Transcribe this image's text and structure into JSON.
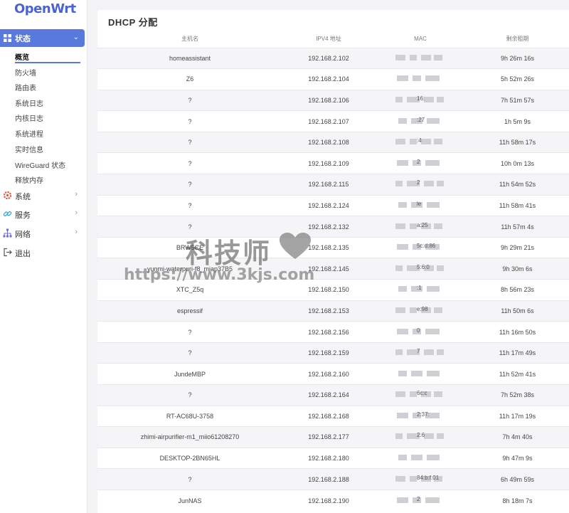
{
  "brand": {
    "logo_text": "OpenWrt",
    "accent": "#5a79dc"
  },
  "sidebar": {
    "active_section": {
      "label": "状态",
      "icon": "grid-icon"
    },
    "status_items": [
      "概览",
      "防火墙",
      "路由表",
      "系统日志",
      "内核日志",
      "系统进程",
      "实时信息",
      "WireGuard 状态",
      "释放内存"
    ],
    "active_sub_index": 0,
    "sections": [
      {
        "label": "系统",
        "icon": "gear-icon",
        "icon_color": "#e0553a"
      },
      {
        "label": "服务",
        "icon": "link-icon",
        "icon_color": "#3aa6d8"
      },
      {
        "label": "网络",
        "icon": "network-icon",
        "icon_color": "#6a6fd0"
      },
      {
        "label": "退出",
        "icon": "logout-icon",
        "icon_color": "#555555"
      }
    ]
  },
  "main": {
    "title": "DHCP 分配",
    "columns": [
      "主机名",
      "IPV4 地址",
      "MAC",
      "剩余租期"
    ],
    "rows": [
      {
        "host": "homeassistant",
        "ip": "192.168.2.102",
        "mac_frag": "",
        "lease": "9h 26m 16s"
      },
      {
        "host": "Z6",
        "ip": "192.168.2.104",
        "mac_frag": "",
        "lease": "5h 52m 26s"
      },
      {
        "host": "?",
        "ip": "192.168.2.106",
        "mac_frag": "16:",
        "lease": "7h 51m 57s"
      },
      {
        "host": "?",
        "ip": "192.168.2.107",
        "mac_frag": ":27",
        "lease": "1h 5m 9s"
      },
      {
        "host": "?",
        "ip": "192.168.2.108",
        "mac_frag": ":4",
        "lease": "11h 58m 17s"
      },
      {
        "host": "?",
        "ip": "192.168.2.109",
        "mac_frag": "2",
        "lease": "10h 0m 13s"
      },
      {
        "host": "?",
        "ip": "192.168.2.115",
        "mac_frag": "2",
        "lease": "11h 54m 52s"
      },
      {
        "host": "?",
        "ip": "192.168.2.124",
        "mac_frag": "le",
        "lease": "11h 58m 41s"
      },
      {
        "host": "?",
        "ip": "192.168.2.132",
        "mac_frag": "a:25",
        "lease": "11h 57m 4s"
      },
      {
        "host": "BRW5CE",
        "ip": "192.168.2.135",
        "mac_frag": "5c:d:86",
        "lease": "9h 29m 21s"
      },
      {
        "host": "yunmi-waterpuri-f8_miap37B5",
        "ip": "192.168.2.145",
        "mac_frag": "5:6:0",
        "lease": "9h 30m 6s"
      },
      {
        "host": "XTC_Z5q",
        "ip": "192.168.2.150",
        "mac_frag": ":1",
        "lease": "8h 56m 23s"
      },
      {
        "host": "espressif",
        "ip": "192.168.2.153",
        "mac_frag": "e:98",
        "lease": "11h 50m 6s"
      },
      {
        "host": "?",
        "ip": "192.168.2.156",
        "mac_frag": "0",
        "lease": "11h 16m 50s"
      },
      {
        "host": "?",
        "ip": "192.168.2.159",
        "mac_frag": "7",
        "lease": "11h 17m 49s"
      },
      {
        "host": "JundeMBP",
        "ip": "192.168.2.160",
        "mac_frag": "",
        "lease": "11h 52m 41s"
      },
      {
        "host": "?",
        "ip": "192.168.2.164",
        "mac_frag": "6c:c",
        "lease": "7h 52m 38s"
      },
      {
        "host": "RT-AC68U-3758",
        "ip": "192.168.2.168",
        "mac_frag": "2:37:",
        "lease": "11h 17m 19s"
      },
      {
        "host": "zhimi-airpurifier-m1_miio61208270",
        "ip": "192.168.2.177",
        "mac_frag": "2:6",
        "lease": "7h 4m 40s"
      },
      {
        "host": "DESKTOP-2BN65HL",
        "ip": "192.168.2.180",
        "mac_frag": "",
        "lease": "9h 47m 9s"
      },
      {
        "host": "?",
        "ip": "192.168.2.188",
        "mac_frag": "84:b:f:01",
        "lease": "6h 49m 59s"
      },
      {
        "host": "JunNAS",
        "ip": "192.168.2.190",
        "mac_frag": "2",
        "lease": "8h 18m 7s"
      }
    ]
  },
  "watermark": {
    "text": "科技师",
    "url": "https://www.3kjs.com"
  }
}
